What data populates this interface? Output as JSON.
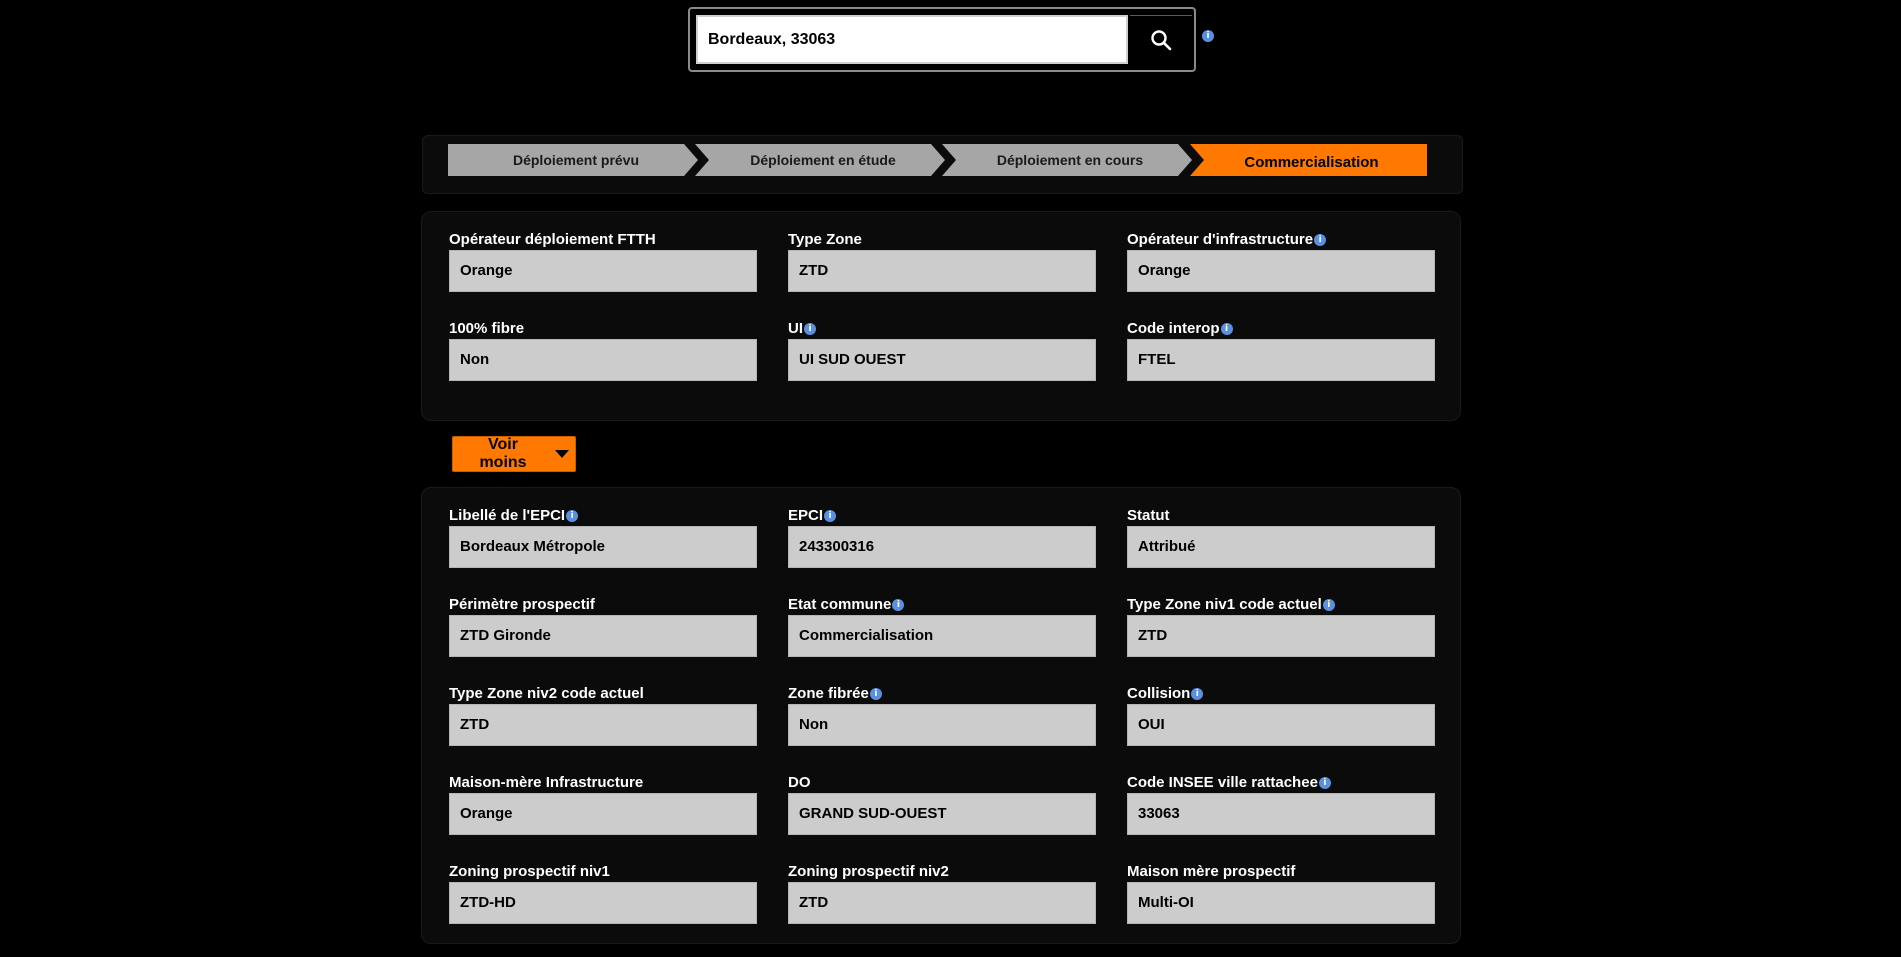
{
  "search": {
    "value": "Bordeaux, 33063",
    "button_icon": "search-icon",
    "info_icon": "info-icon"
  },
  "steps": [
    {
      "label": "Déploiement prévu",
      "state": "inactive"
    },
    {
      "label": "Déploiement en étude",
      "state": "inactive"
    },
    {
      "label": "Déploiement en cours",
      "state": "inactive"
    },
    {
      "label": "Commercialisation",
      "state": "active"
    }
  ],
  "colors": {
    "accent": "#ff7900",
    "step_inactive": "#a6a6a6",
    "field_bg": "#cccccc",
    "info": "#5b8fe0",
    "background": "#000000"
  },
  "summary_fields": [
    {
      "label": "Opérateur déploiement FTTH",
      "value": "Orange",
      "info": false
    },
    {
      "label": "Type Zone",
      "value": "ZTD",
      "info": false
    },
    {
      "label": "Opérateur d'infrastructure",
      "value": "Orange",
      "info": true
    },
    {
      "label": "100% fibre",
      "value": "Non",
      "info": false
    },
    {
      "label": "UI",
      "value": "UI SUD OUEST",
      "info": true
    },
    {
      "label": "Code interop",
      "value": "FTEL",
      "info": true
    }
  ],
  "toggle": {
    "label": "Voir moins"
  },
  "detail_fields": [
    {
      "label": "Libellé de l'EPCI",
      "value": "Bordeaux Métropole",
      "info": true
    },
    {
      "label": "EPCI",
      "value": "243300316",
      "info": true
    },
    {
      "label": "Statut",
      "value": "Attribué",
      "info": false
    },
    {
      "label": "Périmètre prospectif",
      "value": "ZTD Gironde",
      "info": false
    },
    {
      "label": "Etat commune",
      "value": "Commercialisation",
      "info": true
    },
    {
      "label": "Type Zone niv1 code actuel",
      "value": "ZTD",
      "info": true
    },
    {
      "label": "Type Zone niv2 code actuel",
      "value": "ZTD",
      "info": false
    },
    {
      "label": "Zone fibrée",
      "value": "Non",
      "info": true
    },
    {
      "label": "Collision",
      "value": "OUI",
      "info": true
    },
    {
      "label": "Maison-mère Infrastructure",
      "value": "Orange",
      "info": false
    },
    {
      "label": "DO",
      "value": "GRAND SUD-OUEST",
      "info": false
    },
    {
      "label": "Code INSEE ville rattachee",
      "value": "33063",
      "info": true
    },
    {
      "label": "Zoning prospectif niv1",
      "value": "ZTD-HD",
      "info": false
    },
    {
      "label": "Zoning prospectif niv2",
      "value": "ZTD",
      "info": false
    },
    {
      "label": "Maison mère prospectif",
      "value": "Multi-OI",
      "info": false
    }
  ]
}
